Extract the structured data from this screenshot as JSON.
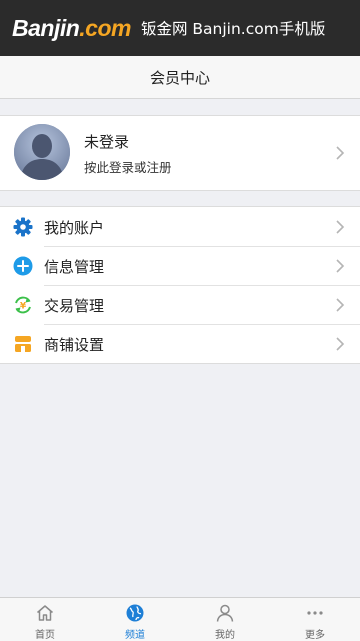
{
  "header": {
    "logo_main": "Banjin",
    "logo_suffix": ".com",
    "site_title": "钣金网 Banjin.com手机版"
  },
  "nav": {
    "title": "会员中心"
  },
  "profile": {
    "name": "未登录",
    "hint": "按此登录或注册"
  },
  "menu": {
    "items": [
      {
        "label": "我的账户",
        "icon": "gear-icon",
        "color": "#1a73c9"
      },
      {
        "label": "信息管理",
        "icon": "plus-circle-icon",
        "color": "#1e9be8"
      },
      {
        "label": "交易管理",
        "icon": "exchange-icon",
        "color": "#3cc04a"
      },
      {
        "label": "商铺设置",
        "icon": "shop-icon",
        "color": "#f5a623"
      }
    ]
  },
  "tabbar": {
    "active": "频道",
    "items": [
      {
        "label": "首页",
        "icon": "home-icon"
      },
      {
        "label": "频道",
        "icon": "globe-icon"
      },
      {
        "label": "我的",
        "icon": "user-icon"
      },
      {
        "label": "更多",
        "icon": "more-icon"
      }
    ]
  },
  "colors": {
    "header_bg": "#2b2b2b",
    "logo_accent": "#f5a623",
    "active_tab": "#1e7fd6",
    "page_bg": "#eff0f4"
  }
}
